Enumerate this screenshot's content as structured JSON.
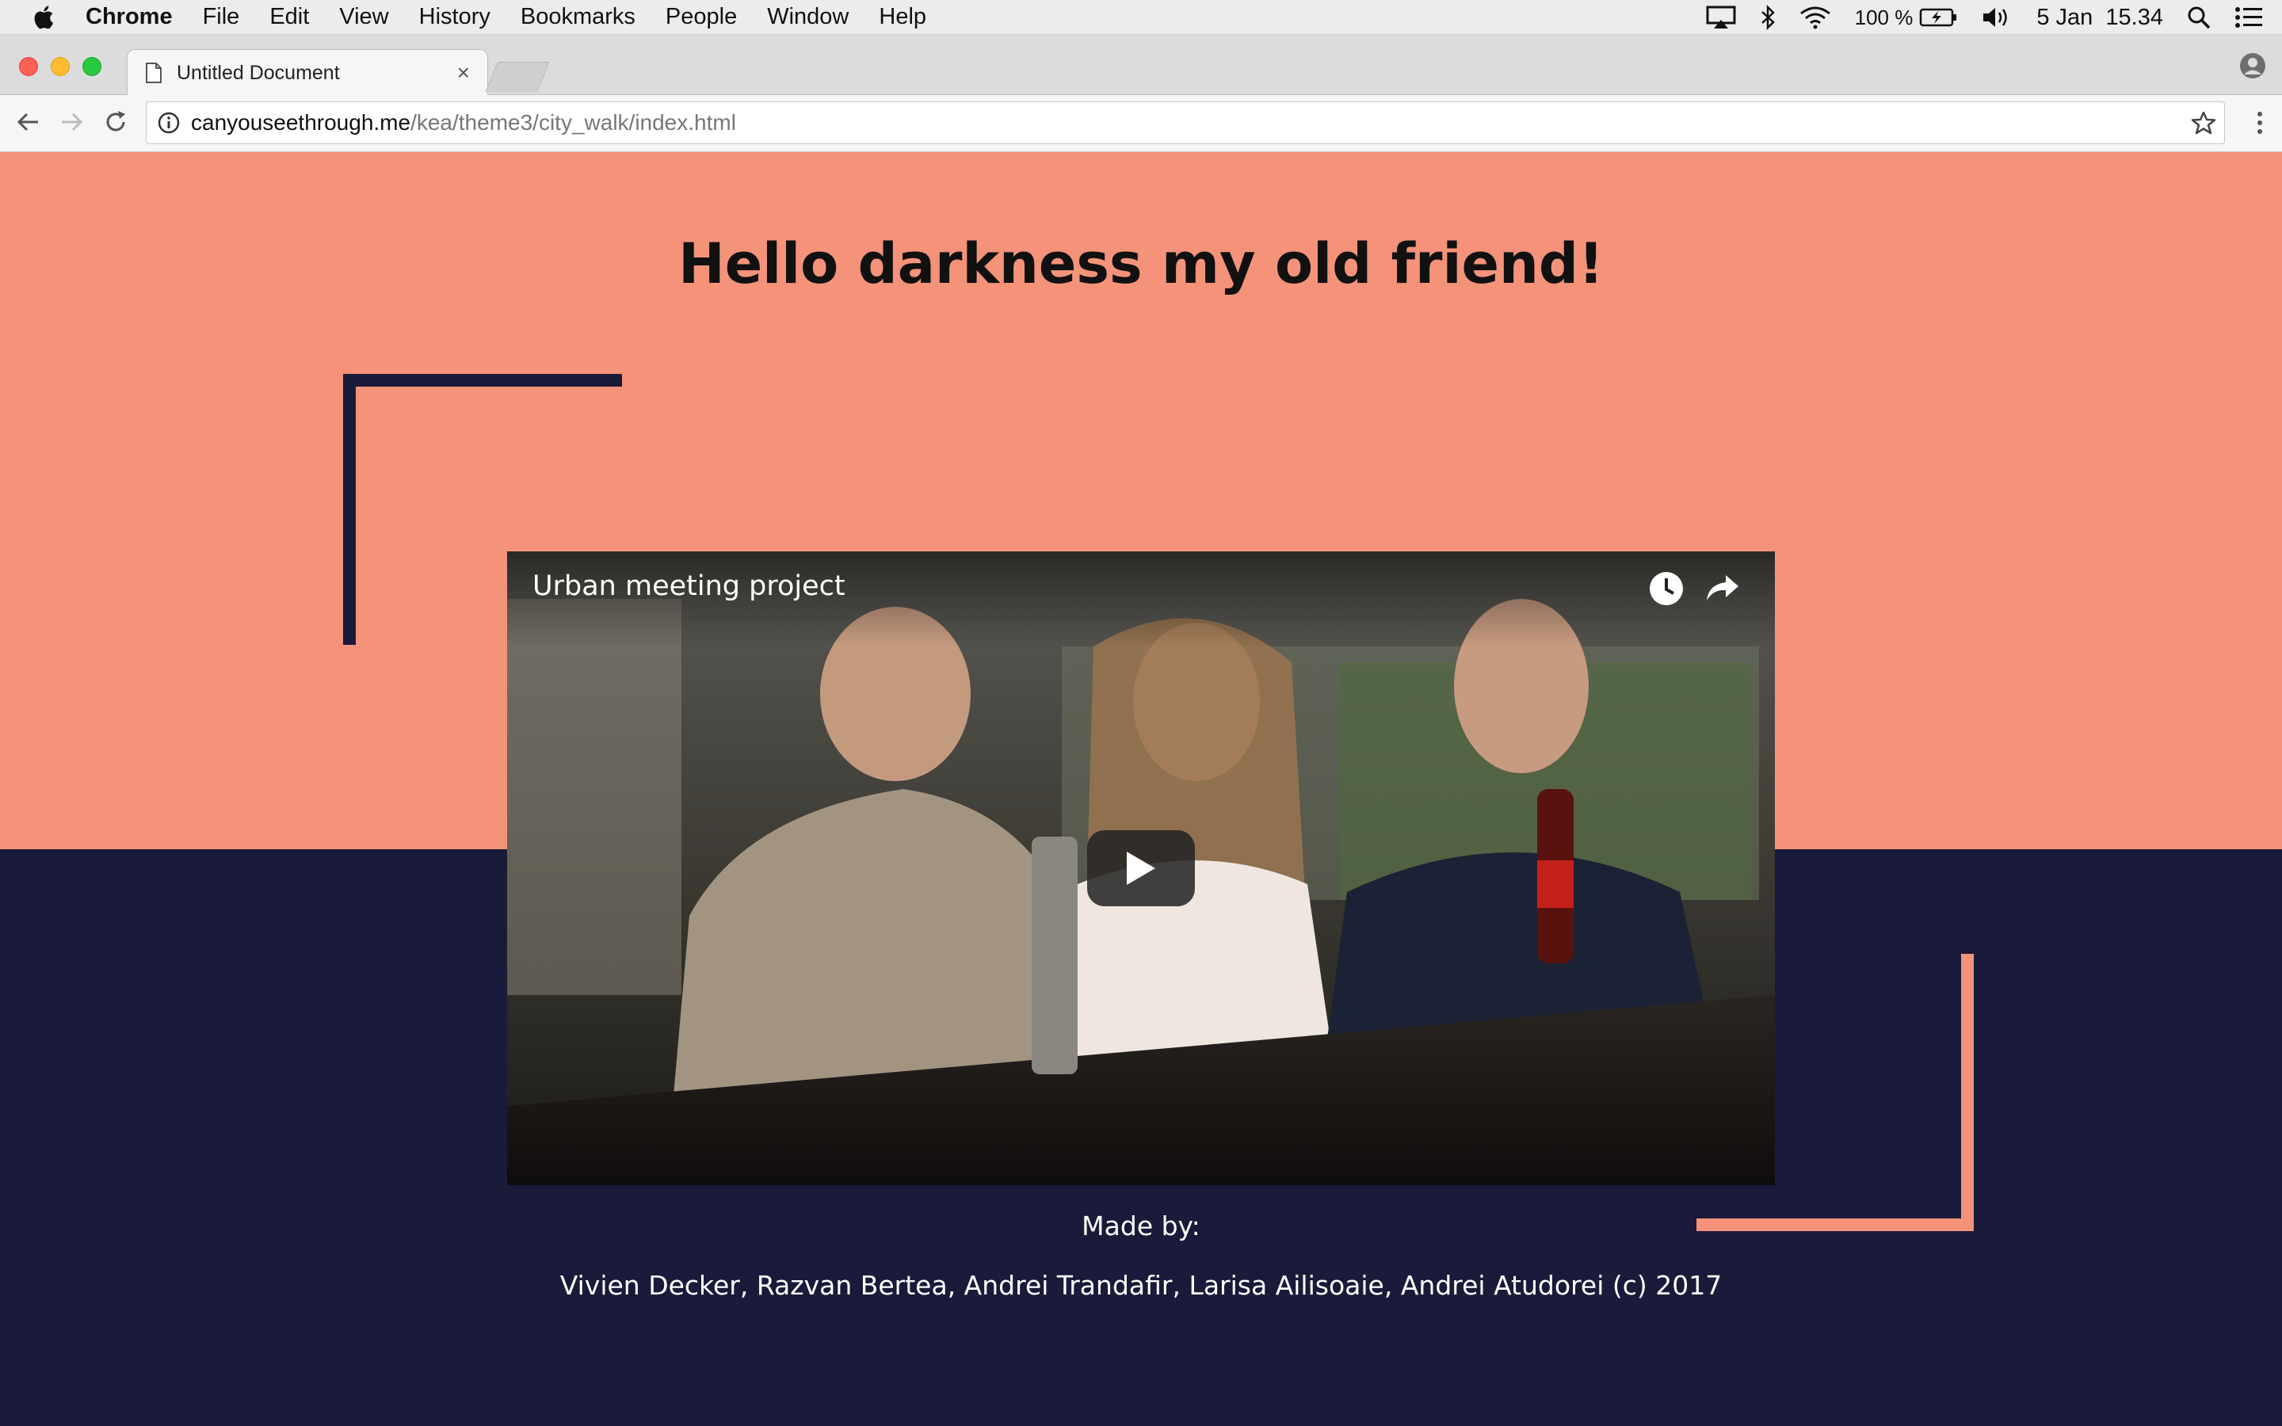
{
  "menubar": {
    "app_name": "Chrome",
    "items": [
      "File",
      "Edit",
      "View",
      "History",
      "Bookmarks",
      "People",
      "Window",
      "Help"
    ],
    "battery": "100 %",
    "clock": "5 Jan  15.34"
  },
  "browser": {
    "tab_title": "Untitled Document",
    "tab_close": "×",
    "url_host": "canyouseethrough.me",
    "url_path": "/kea/theme3/city_walk/index.html"
  },
  "page": {
    "headline": "Hello darkness my old friend!",
    "video": {
      "title": "Urban meeting project"
    },
    "made_by_label": "Made by:",
    "credits": "Vivien Decker, Razvan Bertea, Andrei Trandafir, Larisa Ailisoaie, Andrei Atudorei (c) 2017"
  },
  "colors": {
    "salmon": "#f4937a",
    "navy": "#1a1a3a"
  },
  "icons": [
    "apple-icon",
    "airplay-icon",
    "bluetooth-icon",
    "wifi-icon",
    "battery-icon",
    "volume-icon",
    "spotlight-icon",
    "notification-center-icon",
    "document-icon",
    "profile-icon",
    "back-icon",
    "forward-icon",
    "reload-icon",
    "info-icon",
    "bookmark-star-icon",
    "chrome-menu-icon",
    "watch-later-icon",
    "share-icon",
    "play-icon"
  ]
}
